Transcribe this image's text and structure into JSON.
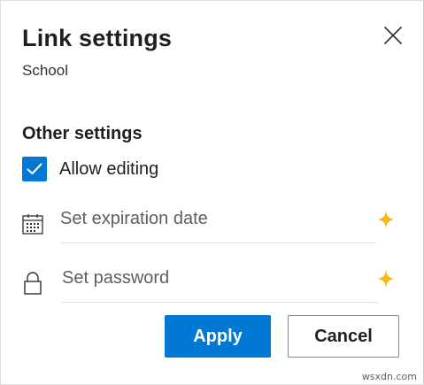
{
  "dialog": {
    "title": "Link settings",
    "subtitle": "School",
    "close_icon": "close-icon"
  },
  "other_settings": {
    "heading": "Other settings",
    "allow_editing": {
      "label": "Allow editing",
      "checked": true,
      "icon": "checkmark-icon"
    },
    "expiration": {
      "placeholder": "Set expiration date",
      "icon": "calendar-icon",
      "badge_icon": "sparkle-icon"
    },
    "password": {
      "placeholder": "Set password",
      "icon": "lock-icon",
      "badge_icon": "sparkle-icon"
    }
  },
  "actions": {
    "apply_label": "Apply",
    "cancel_label": "Cancel"
  },
  "colors": {
    "accent": "#0078d4",
    "sparkle": "#f8b914",
    "text": "#201f1e",
    "placeholder": "#605e5c"
  },
  "watermark": "wsxdn.com"
}
